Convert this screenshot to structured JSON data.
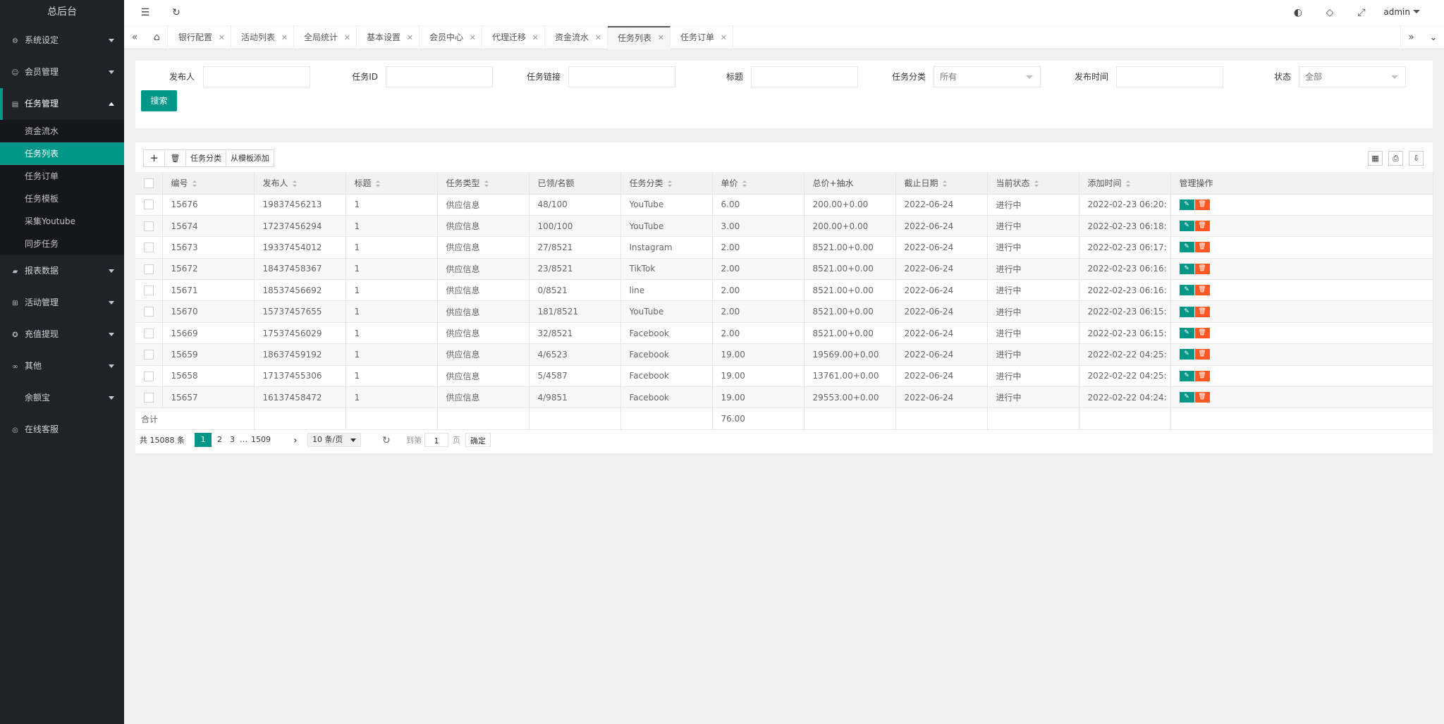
{
  "app": {
    "title": "总后台"
  },
  "sidebar": {
    "items": [
      {
        "label": "系统设定",
        "icon": "gear-icon"
      },
      {
        "label": "会员管理",
        "icon": "user-icon"
      },
      {
        "label": "任务管理",
        "icon": "document-icon"
      },
      {
        "label": "报表数据",
        "icon": "chat-icon"
      },
      {
        "label": "活动管理",
        "icon": "book-icon"
      },
      {
        "label": "充值提现",
        "icon": "shield-icon"
      },
      {
        "label": "其他",
        "icon": "link-icon"
      },
      {
        "label": "余额宝",
        "icon": ""
      },
      {
        "label": "在线客服",
        "icon": "headset-icon"
      }
    ],
    "task_sub": [
      "资金流水",
      "任务列表",
      "任务订单",
      "任务模板",
      "采集Youtube",
      "同步任务"
    ]
  },
  "header": {
    "user": "admin"
  },
  "tabs": [
    "银行配置",
    "活动列表",
    "全局统计",
    "基本设置",
    "会员中心",
    "代理迁移",
    "资金流水",
    "任务列表",
    "任务订单"
  ],
  "search": {
    "publisher_label": "发布人",
    "task_id_label": "任务ID",
    "task_link_label": "任务链接",
    "title_label": "标题",
    "category_label": "任务分类",
    "category_value": "所有",
    "publish_time_label": "发布时间",
    "status_label": "状态",
    "status_value": "全部",
    "search_btn": "搜索"
  },
  "toolbar": {
    "add": "+",
    "delete_icon": "trash-icon",
    "category_btn": "任务分类",
    "template_btn": "从模板添加"
  },
  "table": {
    "columns": [
      "编号",
      "发布人",
      "标题",
      "任务类型",
      "已领/名额",
      "任务分类",
      "单价",
      "总价+抽水",
      "截止日期",
      "当前状态",
      "添加时间",
      "管理操作"
    ],
    "rows": [
      [
        "15676",
        "19837456213",
        "1",
        "供应信息",
        "48/100",
        "YouTube",
        "6.00",
        "200.00+0.00",
        "2022-06-24",
        "进行中",
        "2022-02-23 06:20:"
      ],
      [
        "15674",
        "17237456294",
        "1",
        "供应信息",
        "100/100",
        "YouTube",
        "3.00",
        "200.00+0.00",
        "2022-06-24",
        "进行中",
        "2022-02-23 06:18:"
      ],
      [
        "15673",
        "19337454012",
        "1",
        "供应信息",
        "27/8521",
        "Instagram",
        "2.00",
        "8521.00+0.00",
        "2022-06-24",
        "进行中",
        "2022-02-23 06:17:"
      ],
      [
        "15672",
        "18437458367",
        "1",
        "供应信息",
        "23/8521",
        "TikTok",
        "2.00",
        "8521.00+0.00",
        "2022-06-24",
        "进行中",
        "2022-02-23 06:16:"
      ],
      [
        "15671",
        "18537456692",
        "1",
        "供应信息",
        "0/8521",
        "line",
        "2.00",
        "8521.00+0.00",
        "2022-06-24",
        "进行中",
        "2022-02-23 06:16:"
      ],
      [
        "15670",
        "15737457655",
        "1",
        "供应信息",
        "181/8521",
        "YouTube",
        "2.00",
        "8521.00+0.00",
        "2022-06-24",
        "进行中",
        "2022-02-23 06:15:"
      ],
      [
        "15669",
        "17537456029",
        "1",
        "供应信息",
        "32/8521",
        "Facebook",
        "2.00",
        "8521.00+0.00",
        "2022-06-24",
        "进行中",
        "2022-02-23 06:15:"
      ],
      [
        "15659",
        "18637459192",
        "1",
        "供应信息",
        "4/6523",
        "Facebook",
        "19.00",
        "19569.00+0.00",
        "2022-06-24",
        "进行中",
        "2022-02-22 04:25:"
      ],
      [
        "15658",
        "17137455306",
        "1",
        "供应信息",
        "5/4587",
        "Facebook",
        "19.00",
        "13761.00+0.00",
        "2022-06-24",
        "进行中",
        "2022-02-22 04:25:"
      ],
      [
        "15657",
        "16137458472",
        "1",
        "供应信息",
        "4/9851",
        "Facebook",
        "19.00",
        "29553.00+0.00",
        "2022-06-24",
        "进行中",
        "2022-02-22 04:24:"
      ]
    ],
    "total_label": "合计",
    "total_value": "76.00"
  },
  "pager": {
    "total": "共 15088 条",
    "pages": [
      "1",
      "2",
      "3",
      "…",
      "1509"
    ],
    "per_page": "10 条/页",
    "goto_label": "到第",
    "goto_value": "1",
    "page_unit": "页",
    "confirm": "确定"
  },
  "colors": {
    "accent": "#009688",
    "danger": "#ff5722",
    "sidebar": "#20222a"
  }
}
